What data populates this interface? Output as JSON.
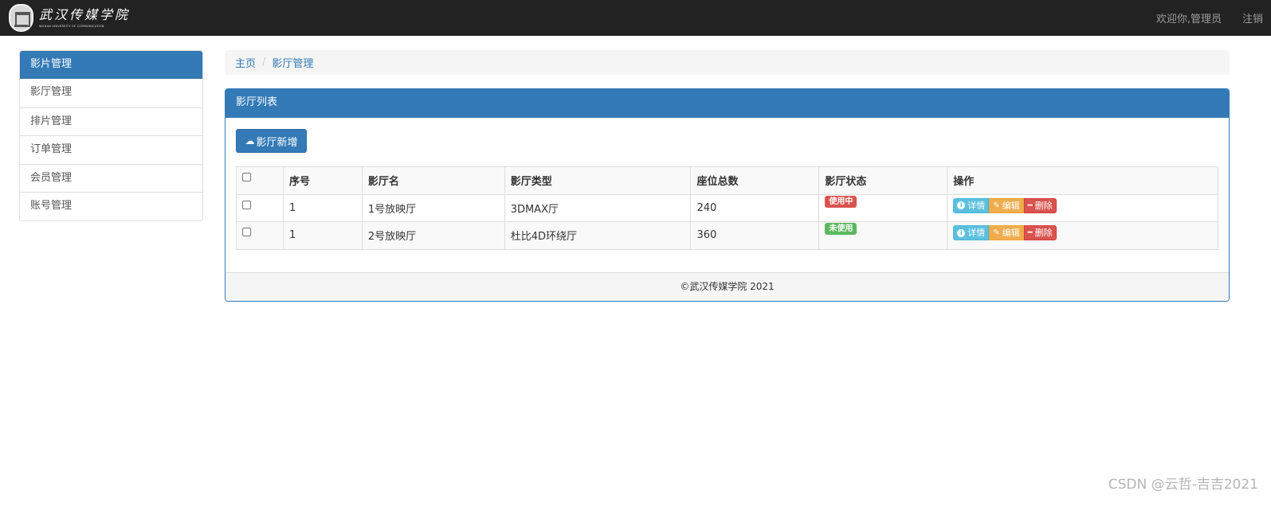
{
  "navbar": {
    "brand_cn": "武汉传媒学院",
    "brand_en": "WUHAN UNIVERSITY OF COMMUNICATION",
    "welcome": "欢迎你,管理员",
    "logout": "注销"
  },
  "sidebar": {
    "items": [
      {
        "label": "影片管理",
        "active": true
      },
      {
        "label": "影厅管理",
        "active": false
      },
      {
        "label": "排片管理",
        "active": false
      },
      {
        "label": "订单管理",
        "active": false
      },
      {
        "label": "会员管理",
        "active": false
      },
      {
        "label": "账号管理",
        "active": false
      }
    ]
  },
  "breadcrumb": {
    "home": "主页",
    "separator": "/",
    "current": "影厅管理"
  },
  "panel": {
    "title": "影厅列表",
    "add_button": "影厅新增",
    "table": {
      "headers": [
        "序号",
        "影厅名",
        "影厅类型",
        "座位总数",
        "影厅状态",
        "操作"
      ],
      "rows": [
        {
          "id": "1",
          "name": "1号放映厅",
          "type": "3DMAX厅",
          "seats": "240",
          "status": "使用中",
          "status_color": "#d9534f"
        },
        {
          "id": "1",
          "name": "2号放映厅",
          "type": "杜比4D环绕厅",
          "seats": "360",
          "status": "未使用",
          "status_color": "#5cb85c"
        }
      ],
      "actions": {
        "detail": "详情",
        "edit": "编辑",
        "delete": "删除"
      }
    },
    "footer": "©武汉传媒学院 2021"
  },
  "watermark": "CSDN @云哲-吉吉2021",
  "colors": {
    "primary": "#337ab7",
    "navbar": "#222222",
    "info": "#5bc0de",
    "warning": "#f0ad4e",
    "danger": "#d9534f",
    "success": "#5cb85c"
  }
}
